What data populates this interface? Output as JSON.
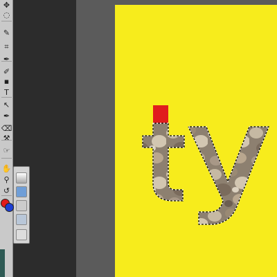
{
  "toolbar": {
    "tools": [
      {
        "name": "move-tool",
        "icon": "move-icon",
        "glyph": "✥"
      },
      {
        "name": "lasso-tool",
        "icon": "lasso-icon",
        "glyph": "◌"
      },
      {
        "name": "quick-selection-tool",
        "icon": "quick-selection-icon",
        "glyph": "✎"
      },
      {
        "name": "crop-tool",
        "icon": "crop-icon",
        "glyph": "⌗"
      },
      {
        "name": "eyedropper-tool",
        "icon": "eyedropper-icon",
        "glyph": "✒"
      },
      {
        "name": "brush-tool",
        "icon": "brush-icon",
        "glyph": "✐"
      },
      {
        "name": "rectangle-tool",
        "icon": "rectangle-icon",
        "glyph": "▪"
      },
      {
        "name": "type-tool",
        "icon": "type-icon",
        "glyph": "T"
      },
      {
        "name": "path-selection-tool",
        "icon": "arrow-icon",
        "glyph": "↖"
      },
      {
        "name": "pen-tool",
        "icon": "pen-icon",
        "glyph": "✒"
      },
      {
        "name": "eraser-tool",
        "icon": "eraser-icon",
        "glyph": "⌫"
      },
      {
        "name": "clone-tool",
        "icon": "stamp-icon",
        "glyph": "⚒"
      },
      {
        "name": "smudge-tool",
        "icon": "smudge-icon",
        "glyph": "☞"
      },
      {
        "name": "hand-tool",
        "icon": "hand-icon",
        "glyph": "✋"
      },
      {
        "name": "zoom-tool",
        "icon": "zoom-icon",
        "glyph": "⚲"
      },
      {
        "name": "rotate-view-tool",
        "icon": "rotate-icon",
        "glyph": "↺"
      }
    ]
  },
  "colors": {
    "foreground": "#e21b1b",
    "background": "#1d3fd4",
    "canvas": "#f7ec1c"
  },
  "canvas_text": "ty"
}
